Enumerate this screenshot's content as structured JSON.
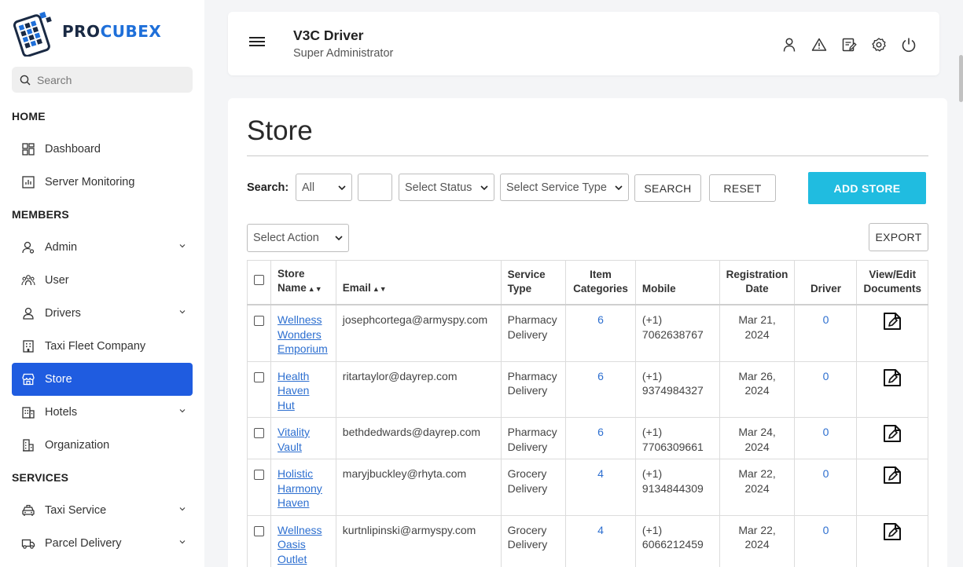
{
  "brand": {
    "part1": "PRO",
    "part2": "CUBEX"
  },
  "sidebar": {
    "search_placeholder": "Search",
    "sections": {
      "home": "HOME",
      "members": "MEMBERS",
      "services": "SERVICES"
    },
    "items": {
      "dashboard": "Dashboard",
      "server_monitoring": "Server Monitoring",
      "admin": "Admin",
      "user": "User",
      "drivers": "Drivers",
      "taxi_fleet": "Taxi Fleet Company",
      "store": "Store",
      "hotels": "Hotels",
      "organization": "Organization",
      "taxi_service": "Taxi Service",
      "parcel_delivery": "Parcel Delivery"
    },
    "active_item": "store",
    "active_color": "#1f5ce0"
  },
  "header": {
    "title": "V3C Driver",
    "subtitle": "Super Administrator",
    "icons": [
      "user-icon",
      "warning-icon",
      "edit-note-icon",
      "settings-icon",
      "power-icon"
    ]
  },
  "page": {
    "title": "Store",
    "filters": {
      "label": "Search:",
      "field_select": "All",
      "status_select": "Select Status",
      "service_type_select": "Select Service Type",
      "search_button": "SEARCH",
      "reset_button": "RESET",
      "add_button": "ADD STORE",
      "add_button_color": "#20bce0"
    },
    "action_select": "Select Action",
    "export_button": "EXPORT"
  },
  "table": {
    "headers": {
      "store_name_1": "Store",
      "store_name_2": "Name",
      "email": "Email",
      "service_type_1": "Service",
      "service_type_2": "Type",
      "item_categories_1": "Item",
      "item_categories_2": "Categories",
      "mobile": "Mobile",
      "registration_1": "Registration",
      "registration_2": "Date",
      "driver": "Driver",
      "documents_1": "View/Edit",
      "documents_2": "Documents"
    },
    "rows": [
      {
        "name_lines": [
          "Wellness",
          "Wonders",
          "Emporium"
        ],
        "email": "josephcortega@armyspy.com",
        "service": [
          "Pharmacy",
          "Delivery"
        ],
        "items": "6",
        "mobile": [
          "(+1)",
          "7062638767"
        ],
        "date": "Mar 21, 2024",
        "driver": "0"
      },
      {
        "name_lines": [
          "Health",
          "Haven Hut"
        ],
        "email": "ritartaylor@dayrep.com",
        "service": [
          "Pharmacy",
          "Delivery"
        ],
        "items": "6",
        "mobile": [
          "(+1)",
          "9374984327"
        ],
        "date": "Mar 26, 2024",
        "driver": "0"
      },
      {
        "name_lines": [
          "Vitality",
          "Vault"
        ],
        "email": "bethdedwards@dayrep.com",
        "service": [
          "Pharmacy",
          "Delivery"
        ],
        "items": "6",
        "mobile": [
          "(+1)",
          "7706309661"
        ],
        "date": "Mar 24, 2024",
        "driver": "0"
      },
      {
        "name_lines": [
          "Holistic",
          "Harmony",
          "Haven"
        ],
        "email": "maryjbuckley@rhyta.com",
        "service": [
          "Grocery",
          "Delivery"
        ],
        "items": "4",
        "mobile": [
          "(+1)",
          "9134844309"
        ],
        "date": "Mar 22, 2024",
        "driver": "0"
      },
      {
        "name_lines": [
          "Wellness",
          "Oasis",
          "Outlet"
        ],
        "email": "kurtnlipinski@armyspy.com",
        "service": [
          "Grocery",
          "Delivery"
        ],
        "items": "4",
        "mobile": [
          "(+1)",
          "6066212459"
        ],
        "date": "Mar 22, 2024",
        "driver": "0"
      }
    ]
  }
}
